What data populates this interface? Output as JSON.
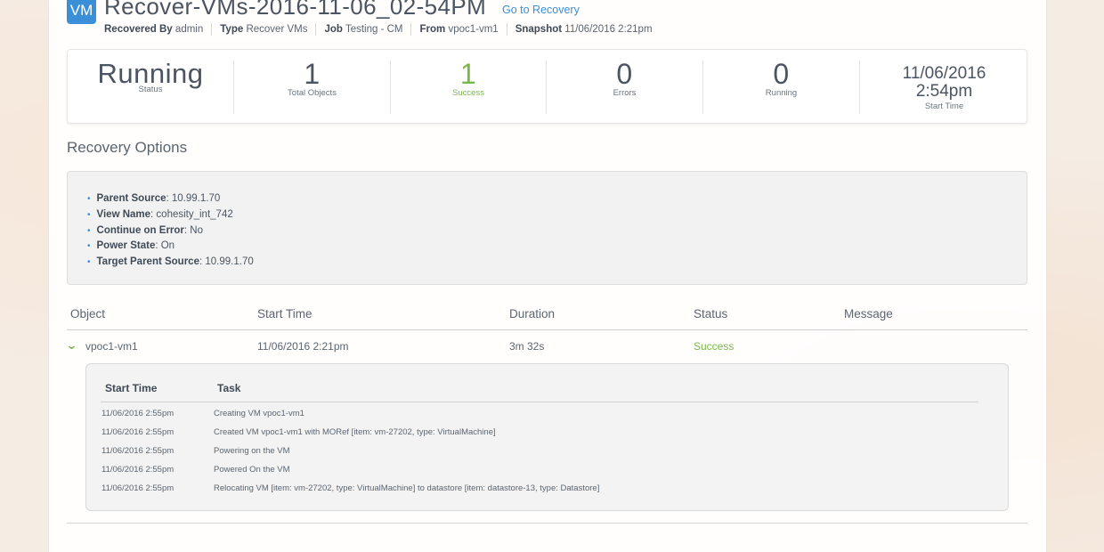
{
  "header": {
    "badge": "VM",
    "title": "Recover-VMs-2016-11-06_02-54PM",
    "link": "Go to Recovery",
    "meta": [
      {
        "key": "Recovered By",
        "value": "admin"
      },
      {
        "key": "Type",
        "value": "Recover VMs"
      },
      {
        "key": "Job",
        "value": "Testing - CM"
      },
      {
        "key": "From",
        "value": "vpoc1-vm1"
      },
      {
        "key": "Snapshot",
        "value": "11/06/2016 2:21pm"
      }
    ]
  },
  "stats": {
    "status": {
      "value": "Running",
      "label": "Status"
    },
    "total": {
      "value": "1",
      "label": "Total Objects"
    },
    "success": {
      "value": "1",
      "label": "Success"
    },
    "errors": {
      "value": "0",
      "label": "Errors"
    },
    "running": {
      "value": "0",
      "label": "Running"
    },
    "start": {
      "date": "11/06/2016",
      "time": "2:54pm",
      "label": "Start Time"
    }
  },
  "recovery_options": {
    "title": "Recovery Options",
    "items": [
      {
        "key": "Parent Source",
        "value": "10.99.1.70"
      },
      {
        "key": "View Name",
        "value": "cohesity_int_742"
      },
      {
        "key": "Continue on Error",
        "value": "No"
      },
      {
        "key": "Power State",
        "value": "On"
      },
      {
        "key": "Target Parent Source",
        "value": "10.99.1.70"
      }
    ]
  },
  "table": {
    "headers": {
      "object": "Object",
      "start": "Start Time",
      "duration": "Duration",
      "status": "Status",
      "message": "Message"
    },
    "row": {
      "object": "vpoc1-vm1",
      "start": "11/06/2016 2:21pm",
      "duration": "3m 32s",
      "status": "Success",
      "message": ""
    }
  },
  "tasks": {
    "headers": {
      "start": "Start Time",
      "task": "Task"
    },
    "rows": [
      {
        "start": "11/06/2016 2:55pm",
        "task": "Creating VM vpoc1-vm1"
      },
      {
        "start": "11/06/2016 2:55pm",
        "task": "Created VM vpoc1-vm1 with MORef [item: vm-27202, type: VirtualMachine]"
      },
      {
        "start": "11/06/2016 2:55pm",
        "task": "Powering on the VM"
      },
      {
        "start": "11/06/2016 2:55pm",
        "task": "Powered On the VM"
      },
      {
        "start": "11/06/2016 2:55pm",
        "task": "Relocating VM [item: vm-27202, type: VirtualMachine] to datastore [item: datastore-13, type: Datastore]"
      }
    ]
  },
  "colors": {
    "accent": "#3b8fd9",
    "success": "#78b84a"
  },
  "icons": {
    "expand": "chevron-down-icon",
    "bullet": "bullet-icon"
  }
}
